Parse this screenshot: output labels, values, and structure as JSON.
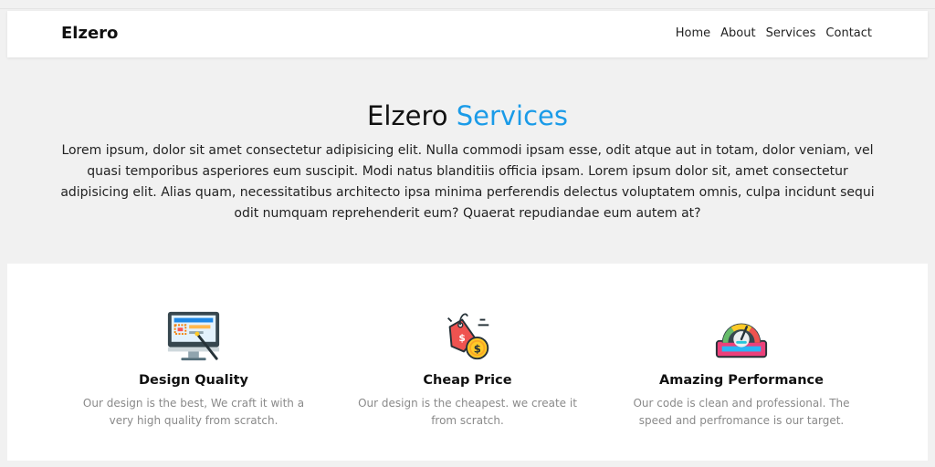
{
  "header": {
    "logo": "Elzero",
    "nav": [
      "Home",
      "About",
      "Services",
      "Contact"
    ]
  },
  "hero": {
    "title_main": "Elzero",
    "title_accent": "Services",
    "accent_color": "#1a9be8",
    "paragraph": "Lorem ipsum, dolor sit amet consectetur adipisicing elit. Nulla commodi ipsam esse, odit atque aut in totam, dolor veniam, vel quasi temporibus asperiores eum suscipit. Modi natus blanditiis officia ipsam. Lorem ipsum dolor sit, amet consectetur adipisicing elit. Alias quam, necessitatibus architecto ipsa minima perferendis delectus voluptatem omnis, culpa incidunt sequi odit numquam reprehenderit eum? Quaerat repudiandae eum autem at?"
  },
  "features": [
    {
      "icon": "design-monitor-icon",
      "title": "Design Quality",
      "text": "Our design is the best, We craft it with a very high quality from scratch."
    },
    {
      "icon": "price-tag-icon",
      "title": "Cheap Price",
      "text": "Our design is the cheapest. we create it from scratch."
    },
    {
      "icon": "speedometer-icon",
      "title": "Amazing Performance",
      "text": "Our code is clean and professional. The speed and perfromance is our target."
    }
  ]
}
